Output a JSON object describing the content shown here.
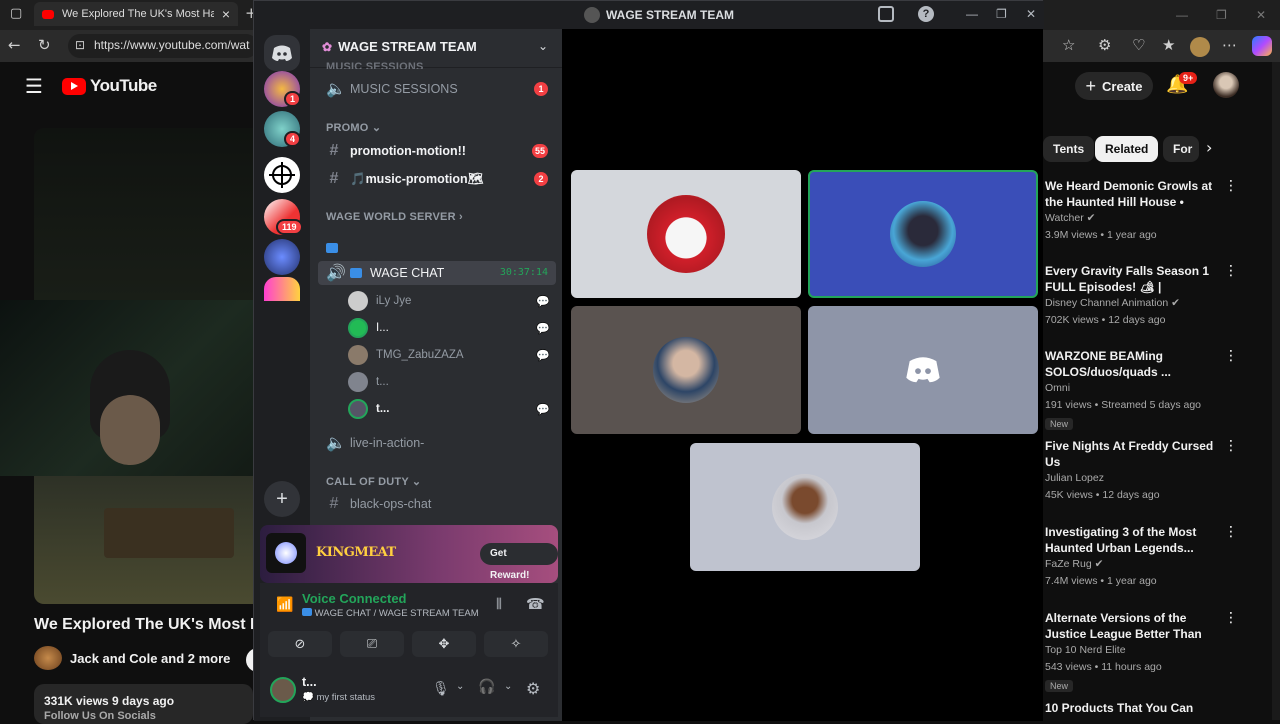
{
  "browser": {
    "tab_title": "We Explored The UK's Most Haun",
    "tab_close": "×",
    "new_tab": "+",
    "url": "https://www.youtube.com/wat",
    "window_controls": [
      "—",
      "❐",
      "✕"
    ]
  },
  "youtube": {
    "logo": "YouTube",
    "video_title": "We Explored The UK's Most H",
    "channel": "Jack and Cole and 2 more",
    "desc": "331K views  9 days ago",
    "desc2": "Follow Us On Socials",
    "create": "Create",
    "notif_count": "9+",
    "chips": [
      "Tents",
      "Related",
      "For"
    ],
    "recommendations": [
      {
        "title": "We Heard Demonic Growls at the Haunted Hill House • Ghos...",
        "channel": "Watcher ✔",
        "meta": "3.9M views • 1 year ago",
        "badge": ""
      },
      {
        "title": "Every Gravity Falls Season 1 FULL Episodes! 🏕 | Marathon...",
        "channel": "Disney Channel Animation ✔",
        "meta": "702K views • 12 days ago",
        "badge": ""
      },
      {
        "title": "WARZONE BEAMing SOLOS/duos/quads ...",
        "channel": "Omni",
        "meta": "191 views • Streamed 5 days ago",
        "badge": "New"
      },
      {
        "title": "Five Nights At Freddy Cursed Us",
        "channel": "Julian Lopez",
        "meta": "45K views • 12 days ago",
        "badge": ""
      },
      {
        "title": "Investigating 3 of the Most Haunted Urban Legends...",
        "channel": "FaZe Rug ✔",
        "meta": "7.4M views • 1 year ago",
        "badge": ""
      },
      {
        "title": "Alternate Versions of the Justice League Better Than Th...",
        "channel": "Top 10 Nerd Elite",
        "meta": "543 views • 11 hours ago",
        "badge": "New"
      },
      {
        "title": "10 Products That You Can",
        "channel": "",
        "meta": "",
        "badge": ""
      }
    ]
  },
  "discord": {
    "window_title": "WAGE STREAM TEAM",
    "server_name": "WAGE STREAM TEAM",
    "guild_badges": [
      "1",
      "4",
      "",
      "119",
      "",
      ""
    ],
    "categories": {
      "music_partial": "MUSIC SESSIONS",
      "promo": "PROMO",
      "world": "WAGE WORLD SERVER",
      "cod": "CALL OF DUTY"
    },
    "channels": {
      "music_sessions": "MUSIC SESSIONS",
      "music_sessions_badge": "1",
      "promotion_motion": "promotion-motion!!",
      "promotion_motion_badge": "55",
      "music_promotion": "🎵music-promotion🗺",
      "music_promotion_badge": "2",
      "wage_chat": "WAGE CHAT",
      "wage_chat_timer": "30:37:14",
      "live_in_action": "live-in-action-",
      "black_ops_chat": "black-ops-chat"
    },
    "voice_users": [
      "iLy Jye",
      "I...",
      "TMG_ZabuZAZA",
      "t...",
      "t..."
    ],
    "promo_banner": {
      "logo_text": "KINGMEAT",
      "button": "Get Reward!"
    },
    "voice": {
      "status": "Voice Connected",
      "location": "WAGE CHAT / WAGE STREAM TEAM"
    },
    "user": {
      "name": "t...",
      "status": "my first status"
    },
    "accent_color": "#5865f2",
    "connected_color": "#23a55a"
  }
}
